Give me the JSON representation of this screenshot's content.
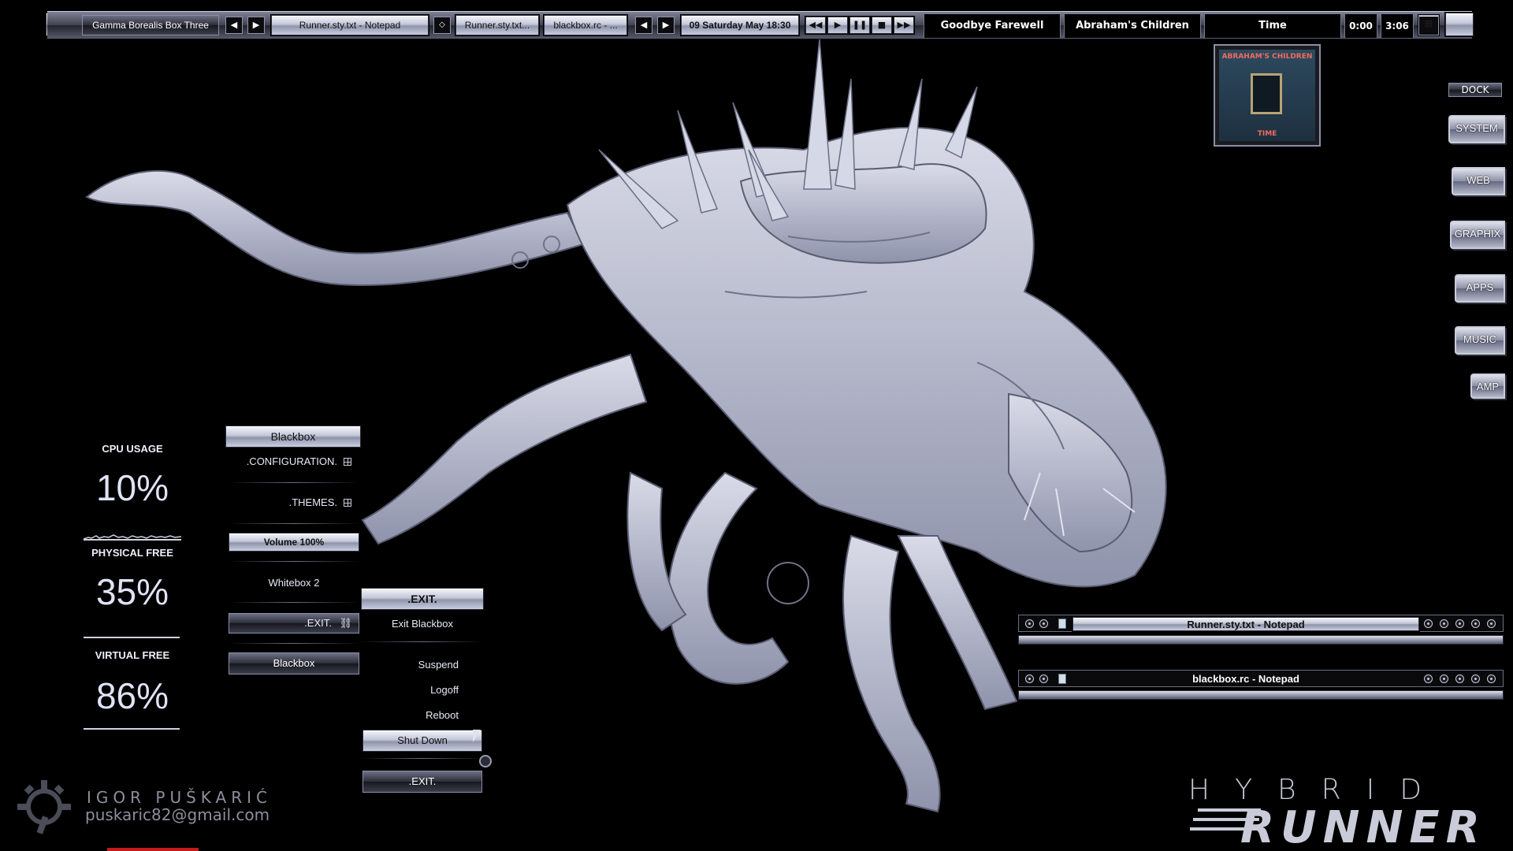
{
  "toolbar": {
    "workspace": "Gamma Borealis Box Three",
    "window1": "Runner.sty.txt - Notepad",
    "window2": "Runner.sty.txt...",
    "window3": "blackbox.rc - ...",
    "clock": "09 Saturday May 18:30",
    "media_prev": "◀◀",
    "media_play": "▶",
    "media_pause": "❚❚",
    "media_stop": "■",
    "media_next": "▶▶",
    "track_title": "Goodbye Farewell",
    "track_artist": "Abraham's Children",
    "track_album": "Time",
    "time_elapsed": "0:00",
    "time_total": "3:06"
  },
  "album_art": {
    "line1": "ABRAHAM'S CHILDREN",
    "line2": "TIME"
  },
  "dock": {
    "label": "DOCK",
    "items": [
      "SYSTEM",
      "WEB",
      "GRAPHIX",
      "APPS",
      "MUSIC",
      "AMP"
    ]
  },
  "monitor": {
    "cpu_label": "CPU USAGE",
    "cpu_value": "10%",
    "physical_label": "PHYSICAL FREE",
    "physical_value": "35%",
    "virtual_label": "VIRTUAL FREE",
    "virtual_value": "86%"
  },
  "menu": {
    "title": "Blackbox",
    "configuration": ".CONFIGURATION.",
    "themes": ".THEMES.",
    "volume": "Volume 100%",
    "whitebox": "Whitebox 2",
    "exit": ".EXIT.",
    "blackbox_footer": "Blackbox",
    "submenu_title": ".EXIT.",
    "exit_blackbox": "Exit  Blackbox",
    "suspend": "Suspend",
    "logoff": "Logoff",
    "reboot": "Reboot",
    "shutdown": "Shut Down",
    "submenu_footer": ".EXIT."
  },
  "windows": {
    "notepad1": "Runner.sty.txt - Notepad",
    "notepad2": "blackbox.rc - Notepad"
  },
  "branding": {
    "hybrid": "HYBRID",
    "runner": "RUNNER",
    "author": "IGOR PUŠKARIĆ",
    "email": "puskaric82@gmail.com"
  }
}
